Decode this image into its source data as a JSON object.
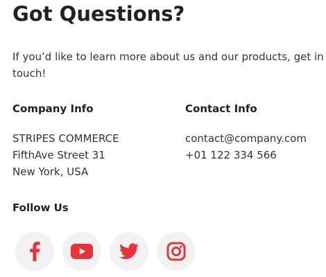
{
  "heading": "Got Questions?",
  "intro": "If you’d like to learn more about us and our products, get in touch!",
  "company_info": {
    "label": "Company Info",
    "lines": [
      "STRIPES COMMERCE",
      "FifthAve Street 31",
      "New York, USA"
    ]
  },
  "contact_info": {
    "label": "Contact Info",
    "lines": [
      "contact@company.com",
      "+01 122 334 566"
    ]
  },
  "follow": {
    "label": "Follow Us",
    "icons": [
      "facebook-icon",
      "youtube-icon",
      "twitter-icon",
      "instagram-icon"
    ]
  },
  "colors": {
    "accent": "#e8333a",
    "icon_bg": "#f2f2f4",
    "text": "#2b2b2b"
  }
}
